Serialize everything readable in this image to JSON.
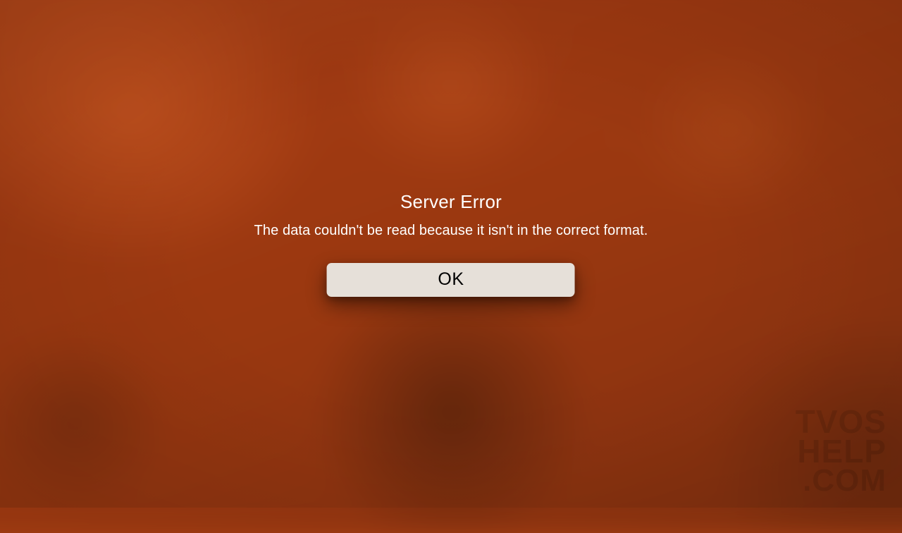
{
  "alert": {
    "title": "Server Error",
    "message": "The data couldn't be read because it isn't in the correct format.",
    "button_label": "OK"
  },
  "watermark": {
    "line1": "TVOS",
    "line2": "HELP",
    "line3": ".COM"
  }
}
